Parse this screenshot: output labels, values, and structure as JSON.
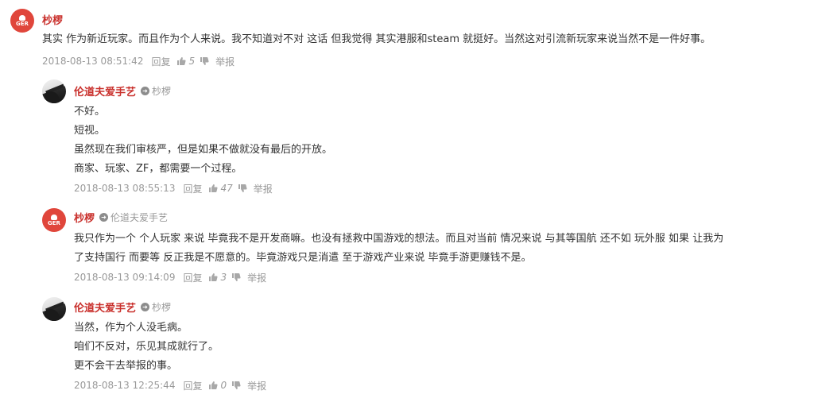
{
  "actions": {
    "reply": "回复",
    "report": "举报"
  },
  "colors": {
    "username": "#c9302c",
    "avatar_bg": "#e0463b",
    "meta": "#999999"
  },
  "comments": [
    {
      "avatar": "GER",
      "username": "杪椤",
      "reply_to": "",
      "lines": [
        "其实 作为新近玩家。而且作为个人来说。我不知道对不对 这话 但我觉得 其实港服和steam 就挺好。当然这对引流新玩家来说当然不是一件好事。"
      ],
      "time": "2018-08-13 08:51:42",
      "likes": "5"
    },
    {
      "avatar": "photo",
      "username": "伦道夫爱手艺",
      "reply_to": "杪椤",
      "lines": [
        "不好。",
        "短视。",
        "虽然现在我们审核严，但是如果不做就没有最后的开放。",
        "商家、玩家、ZF，都需要一个过程。"
      ],
      "time": "2018-08-13 08:55:13",
      "likes": "47"
    },
    {
      "avatar": "GER",
      "username": "杪椤",
      "reply_to": "伦道夫爱手艺",
      "lines": [
        "我只作为一个 个人玩家 来说 毕竟我不是开发商嘛。也没有拯救中国游戏的想法。而且对当前 情况来说 与其等国航 还不如 玩外服 如果 让我为",
        "了支持国行 而要等 反正我是不愿意的。毕竟游戏只是消遣 至于游戏产业来说 毕竟手游更赚钱不是。"
      ],
      "time": "2018-08-13 09:14:09",
      "likes": "3"
    },
    {
      "avatar": "photo",
      "username": "伦道夫爱手艺",
      "reply_to": "杪椤",
      "lines": [
        "当然，作为个人没毛病。",
        "咱们不反对，乐见其成就行了。",
        "更不会干去举报的事。"
      ],
      "time": "2018-08-13 12:25:44",
      "likes": "0"
    }
  ]
}
